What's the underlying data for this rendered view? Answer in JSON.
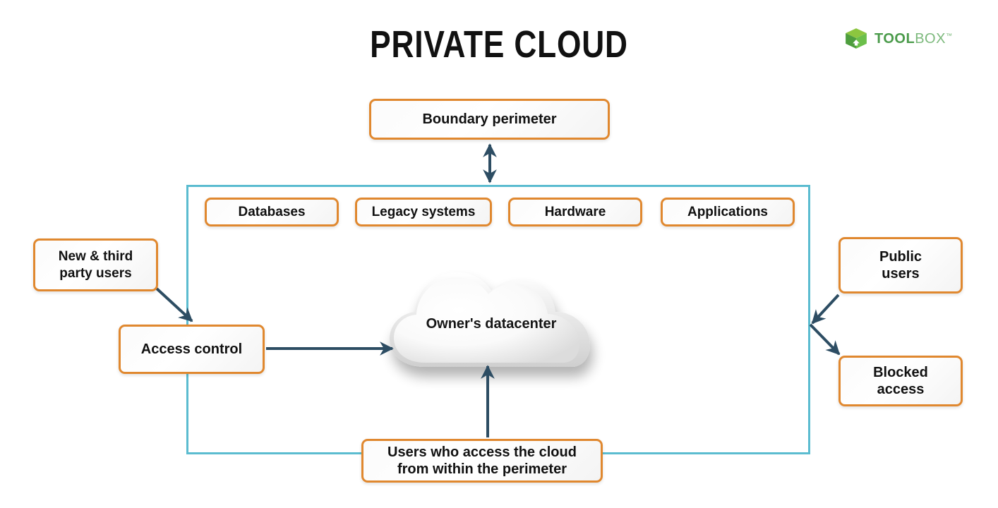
{
  "page": {
    "title": "PRIVATE CLOUD",
    "background_color": "#ffffff"
  },
  "logo": {
    "icon": "green-cube-box-icon",
    "text_bold": "TOOL",
    "text_light": "BOX",
    "trademark": "™",
    "color_dark_green": "#4b9b4b",
    "color_light_green": "#7cb97c"
  },
  "colors": {
    "box_border_orange": "#e0882f",
    "perimeter_blue": "#5bbcd0",
    "arrow_navy": "#2d4d63",
    "text_black": "#111111"
  },
  "boxes": {
    "boundary_perimeter": "Boundary perimeter",
    "databases": "Databases",
    "legacy_systems": "Legacy systems",
    "hardware": "Hardware",
    "applications": "Applications",
    "new_third_party_users_line1": "New & third",
    "new_third_party_users_line2": "party users",
    "access_control": "Access control",
    "public_users_line1": "Public",
    "public_users_line2": "users",
    "blocked_access_line1": "Blocked",
    "blocked_access_line2": "access",
    "within_perimeter_line1": "Users who access the cloud",
    "within_perimeter_line2": "from within the perimeter"
  },
  "cloud": {
    "label": "Owner's datacenter"
  },
  "arrows": [
    {
      "name": "boundary-to-perimeter",
      "type": "double-headed-vertical"
    },
    {
      "name": "new-third-party-to-access-control",
      "type": "diagonal-down-right"
    },
    {
      "name": "access-control-to-datacenter",
      "type": "horizontal-right"
    },
    {
      "name": "within-perimeter-to-datacenter",
      "type": "vertical-up"
    },
    {
      "name": "public-users-to-perimeter",
      "type": "diagonal-down-left"
    },
    {
      "name": "perimeter-to-blocked-access",
      "type": "diagonal-down-right"
    }
  ]
}
